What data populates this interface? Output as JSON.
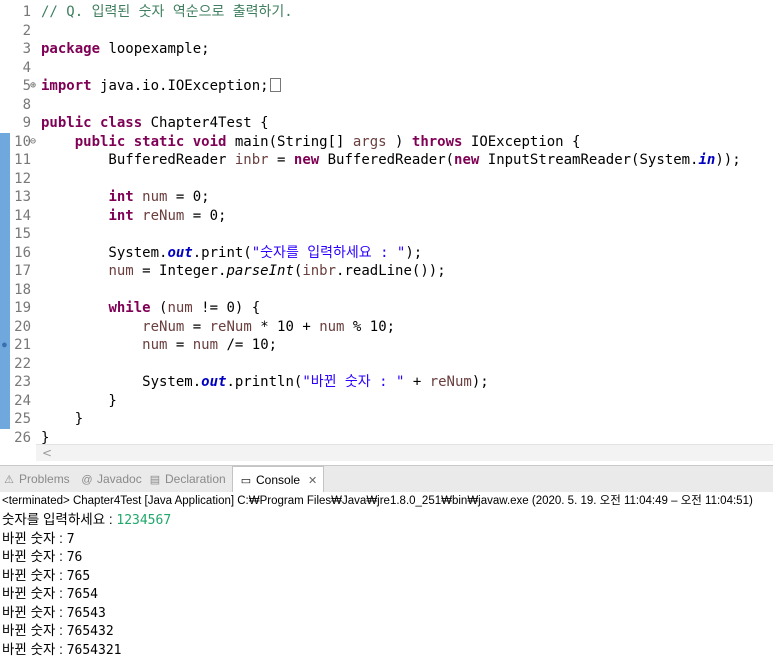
{
  "editor": {
    "lines": [
      {
        "n": "1",
        "parts": [
          [
            "cm",
            "// Q. 입력된 숫자 역순으로 출력하기."
          ]
        ]
      },
      {
        "n": "2",
        "parts": []
      },
      {
        "n": "3",
        "parts": [
          [
            "kw",
            "package"
          ],
          [
            "",
            "loopexample;"
          ]
        ]
      },
      {
        "n": "4",
        "parts": []
      },
      {
        "n": "5",
        "fold": "⊕",
        "parts": [
          [
            "kw",
            "import"
          ],
          [
            "",
            "java.io.IOException;"
          ]
        ]
      },
      {
        "n": "8",
        "parts": []
      },
      {
        "n": "9",
        "parts": [
          [
            "kw",
            "public class"
          ],
          [
            "",
            " Chapter4Test {"
          ]
        ]
      },
      {
        "n": "10",
        "fold": "⊖",
        "parts": [
          [
            "",
            "    "
          ],
          [
            "kw",
            "public static void"
          ],
          [
            "",
            " main(String[] "
          ],
          [
            "var",
            "args"
          ],
          [
            "",
            " ) "
          ],
          [
            "kw",
            "throws"
          ],
          [
            "",
            " IOException {"
          ]
        ]
      },
      {
        "n": "11",
        "parts": [
          [
            "",
            "        BufferedReader "
          ],
          [
            "var",
            "inbr"
          ],
          [
            "",
            " = "
          ],
          [
            "kw",
            "new"
          ],
          [
            "",
            " BufferedReader("
          ],
          [
            "kw",
            "new"
          ],
          [
            "",
            " InputStreamReader(System."
          ],
          [
            "fld",
            "in"
          ],
          [
            "",
            "));"
          ]
        ]
      },
      {
        "n": "12",
        "parts": []
      },
      {
        "n": "13",
        "parts": [
          [
            "",
            "        "
          ],
          [
            "kw",
            "int"
          ],
          [
            "",
            " "
          ],
          [
            "var",
            "num"
          ],
          [
            "",
            " = 0;"
          ]
        ]
      },
      {
        "n": "14",
        "parts": [
          [
            "",
            "        "
          ],
          [
            "kw",
            "int"
          ],
          [
            "",
            " "
          ],
          [
            "var",
            "reNum"
          ],
          [
            "",
            " = 0;"
          ]
        ]
      },
      {
        "n": "15",
        "parts": []
      },
      {
        "n": "16",
        "parts": [
          [
            "",
            "        System."
          ],
          [
            "fld",
            "out"
          ],
          [
            "",
            ".print("
          ],
          [
            "str",
            "\"숫자를 입력하세요 : \""
          ],
          [
            "",
            ");"
          ]
        ]
      },
      {
        "n": "17",
        "parts": [
          [
            "",
            "        "
          ],
          [
            "var",
            "num"
          ],
          [
            "",
            " = Integer."
          ],
          [
            "ital",
            "parseInt"
          ],
          [
            "",
            "("
          ],
          [
            "var",
            "inbr"
          ],
          [
            "",
            ".readLine());"
          ]
        ]
      },
      {
        "n": "18",
        "parts": []
      },
      {
        "n": "19",
        "parts": [
          [
            "",
            "        "
          ],
          [
            "kw",
            "while"
          ],
          [
            "",
            " ("
          ],
          [
            "var",
            "num"
          ],
          [
            "",
            " != 0) {"
          ]
        ]
      },
      {
        "n": "20",
        "parts": [
          [
            "",
            "            "
          ],
          [
            "var",
            "reNum"
          ],
          [
            "",
            " = "
          ],
          [
            "var",
            "reNum"
          ],
          [
            "",
            " * 10 + "
          ],
          [
            "var",
            "num"
          ],
          [
            "",
            " % 10;"
          ]
        ]
      },
      {
        "n": "21",
        "parts": [
          [
            "",
            "            "
          ],
          [
            "var",
            "num"
          ],
          [
            "",
            " = "
          ],
          [
            "var",
            "num"
          ],
          [
            "",
            " /= 10;"
          ]
        ]
      },
      {
        "n": "22",
        "parts": []
      },
      {
        "n": "23",
        "parts": [
          [
            "",
            "            System."
          ],
          [
            "fld",
            "out"
          ],
          [
            "",
            ".println("
          ],
          [
            "str",
            "\"바뀐 숫자 : \""
          ],
          [
            "",
            " + "
          ],
          [
            "var",
            "reNum"
          ],
          [
            "",
            ");"
          ]
        ]
      },
      {
        "n": "24",
        "parts": [
          [
            "",
            "        }"
          ]
        ]
      },
      {
        "n": "25",
        "parts": [
          [
            "",
            "    }"
          ]
        ]
      },
      {
        "n": "26",
        "parts": [
          [
            "",
            "}"
          ]
        ]
      }
    ],
    "scroll_left_glyph": "<"
  },
  "views": {
    "tabs": [
      {
        "label": "Problems",
        "icon": "problems-icon",
        "glyph": "⚠"
      },
      {
        "label": "Javadoc",
        "icon": "javadoc-icon",
        "glyph": "@"
      },
      {
        "label": "Declaration",
        "icon": "declaration-icon",
        "glyph": "▤"
      },
      {
        "label": "Console",
        "icon": "console-icon",
        "glyph": "▭",
        "active": true
      }
    ],
    "close_glyph": "✕"
  },
  "console": {
    "status": "<terminated> Chapter4Test [Java Application] C:₩Program Files₩Java₩jre1.8.0_251₩bin₩javaw.exe  (2020. 5. 19. 오전 11:04:49 – 오전 11:04:51)",
    "prompt": "숫자를 입력하세요 : ",
    "input": "1234567",
    "output_label": "바뀐 숫자 : ",
    "outputs": [
      "7",
      "76",
      "765",
      "7654",
      "76543",
      "765432",
      "7654321"
    ]
  },
  "colors": {
    "keyword": "#7f0055",
    "comment": "#3f7f5f",
    "string": "#2a00ff",
    "field": "#0000c0",
    "change_bar": "#6fa8dc",
    "console_input": "#1fa86a"
  }
}
